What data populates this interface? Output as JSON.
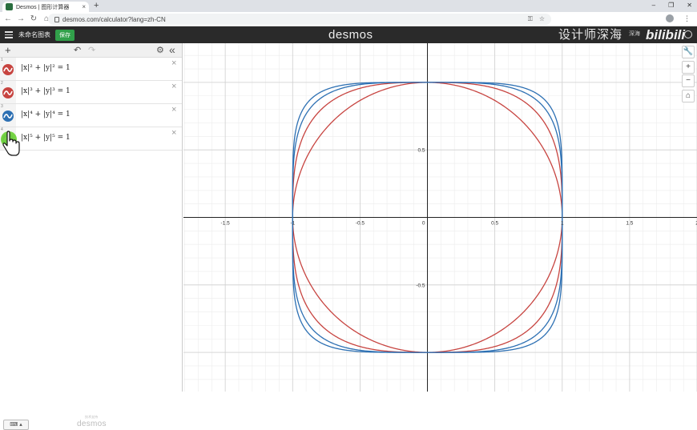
{
  "browser": {
    "tab_title": "Desmos | 图形计算器",
    "tab_close": "×",
    "new_tab": "+",
    "url": "desmos.com/calculator?lang=zh-CN",
    "win_minimize": "–",
    "win_restore": "❐",
    "win_close": "✕"
  },
  "header": {
    "graph_title": "未命名图表",
    "save_label": "保存",
    "logo": "desmos",
    "watermark": "设计师深海",
    "lang_label": "深海",
    "bilibili": "bilibili"
  },
  "expressions": [
    {
      "num": "1",
      "color": "#c74440",
      "latex_base": "x",
      "exp": "2",
      "text": "|x|² + |y|² = 1"
    },
    {
      "num": "2",
      "color": "#c74440",
      "latex_base": "x",
      "exp": "3",
      "text": "|x|³ + |y|³ = 1"
    },
    {
      "num": "3",
      "color": "#2d70b3",
      "latex_base": "x",
      "exp": "4",
      "text": "|x|⁴ + |y|⁴ = 1"
    },
    {
      "num": "4",
      "color": "#2d70b3",
      "latex_base": "x",
      "exp": "5",
      "text": "|x|⁵ + |y|⁵ = 1"
    }
  ],
  "expr_panel": {
    "add": "+",
    "undo": "↶",
    "redo": "↷",
    "settings": "⚙",
    "collapse": "«",
    "delete": "×",
    "keyboard": "⌨ ▴",
    "powered_by": "技术支持",
    "powered_logo": "desmos"
  },
  "zoom": {
    "tools": "🔧",
    "zoom_in": "+",
    "zoom_out": "−",
    "home": "⌂"
  },
  "chart_data": {
    "type": "line",
    "x_ticks": [
      "-1.5",
      "-1",
      "-0.5",
      "0",
      "0.5",
      "1",
      "1.5",
      "2"
    ],
    "y_ticks": [
      "0.5",
      "-0.5"
    ],
    "xlim": [
      -1.81,
      2.0
    ],
    "ylim": [
      -1.29,
      1.29
    ],
    "grid": true,
    "series": [
      {
        "exponent": 2,
        "color": "#c74440"
      },
      {
        "exponent": 3,
        "color": "#c74440"
      },
      {
        "exponent": 4,
        "color": "#2d70b3"
      },
      {
        "exponent": 5,
        "color": "#2d70b3"
      }
    ]
  }
}
